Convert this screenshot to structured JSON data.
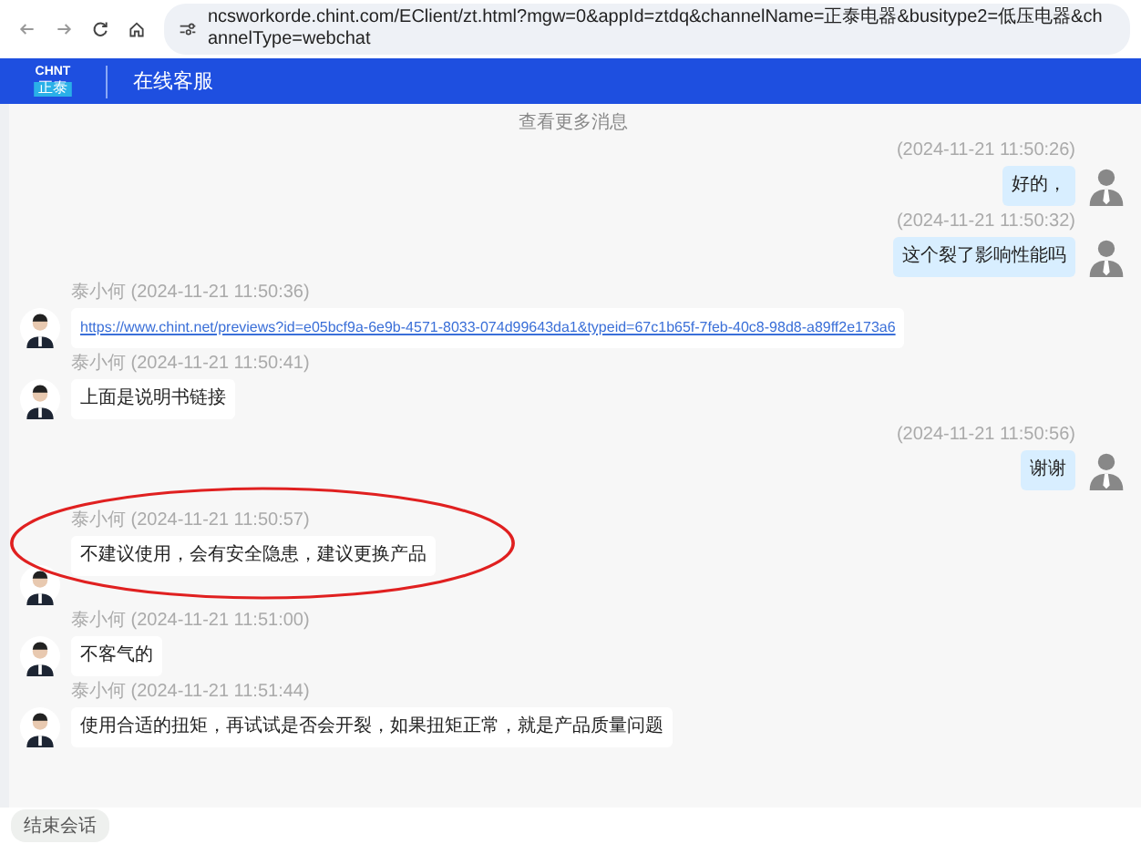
{
  "browser": {
    "url": "ncsworkorde.chint.com/EClient/zt.html?mgw=0&appId=ztdq&channelName=正泰电器&busitype2=低压电器&channelType=webchat"
  },
  "header": {
    "logo": "CHNT",
    "logo_sub": "正泰",
    "title": "在线客服"
  },
  "chat": {
    "more_link": "查看更多消息",
    "messages": [
      {
        "kind": "user",
        "time": "(2024-11-21 11:50:26)",
        "text": "好的，"
      },
      {
        "kind": "user",
        "time": "(2024-11-21 11:50:32)",
        "text": "这个裂了影响性能吗"
      },
      {
        "kind": "agent",
        "sender": "泰小何",
        "time": "(2024-11-21 11:50:36)",
        "text": "https://www.chint.net/previews?id=e05bcf9a-6e9b-4571-8033-074d99643da1&typeid=67c1b65f-7feb-40c8-98d8-a89ff2e173a6",
        "link": true,
        "circled": false
      },
      {
        "kind": "agent",
        "sender": "泰小何",
        "time": "(2024-11-21 11:50:41)",
        "text": "上面是说明书链接",
        "link": false,
        "circled": false
      },
      {
        "kind": "user",
        "time": "(2024-11-21 11:50:56)",
        "text": "谢谢"
      },
      {
        "kind": "agent",
        "sender": "泰小何",
        "time": "(2024-11-21 11:50:57)",
        "text": "不建议使用，会有安全隐患，建议更换产品",
        "link": false,
        "circled": true
      },
      {
        "kind": "agent",
        "sender": "泰小何",
        "time": "(2024-11-21 11:51:00)",
        "text": "不客气的",
        "link": false,
        "circled": false
      },
      {
        "kind": "agent",
        "sender": "泰小何",
        "time": "(2024-11-21 11:51:44)",
        "text": "使用合适的扭矩，再试试是否会开裂，如果扭矩正常，就是产品质量问题",
        "link": false,
        "circled": false
      }
    ]
  },
  "footer": {
    "end_button": "结束会话"
  }
}
